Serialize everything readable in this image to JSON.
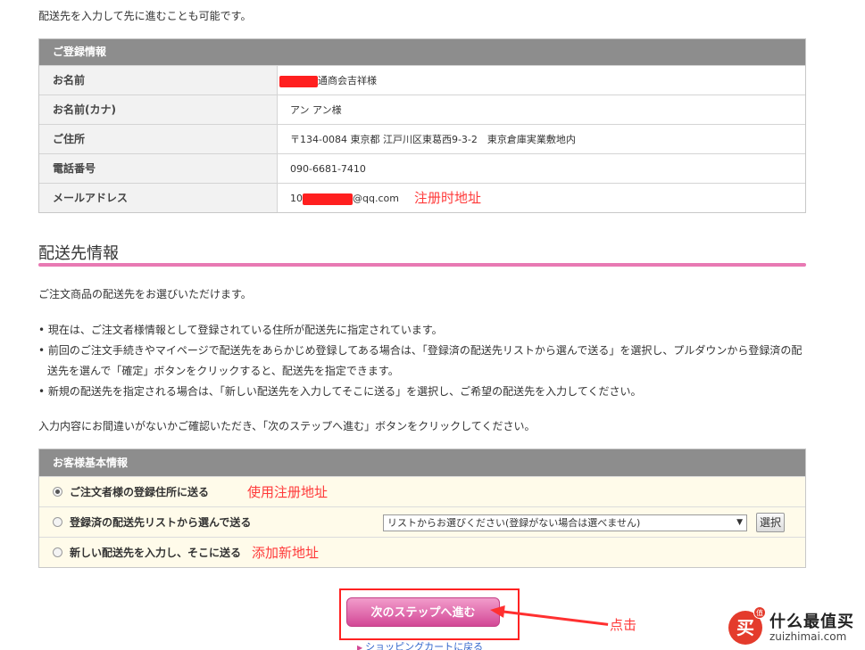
{
  "intro_text": "配送先を入力して先に進むことも可能です。",
  "registration": {
    "header": "ご登録情報",
    "rows": [
      {
        "label": "お名前",
        "value_suffix": "通商会吉祥様"
      },
      {
        "label": "お名前(カナ)",
        "value": "アン アン様"
      },
      {
        "label": "ご住所",
        "value": "〒134-0084 東京都 江戸川区東葛西9-3-2　東京倉庫実業敷地内"
      },
      {
        "label": "電話番号",
        "value": "090-6681-7410"
      },
      {
        "label": "メールアドレス",
        "value_prefix": "10",
        "value_suffix": "@qq.com",
        "annotation": "注册时地址"
      }
    ]
  },
  "delivery": {
    "title": "配送先情報",
    "lead": "ご注文商品の配送先をお選びいただけます。",
    "bullets": [
      "• 現在は、ご注文者様情報として登録されている住所が配送先に指定されています。",
      "• 前回のご注文手続きやマイページで配送先をあらかじめ登録してある場合は、「登録済の配送先リストから選んで送る」を選択し、プルダウンから登録済の配送先を選んで「確定」ボタンをクリックすると、配送先を指定できます。",
      "• 新規の配送先を指定される場合は、「新しい配送先を入力してそこに送る」を選択し、ご希望の配送先を入力してください。"
    ],
    "confirm_text": "入力内容にお間違いがないかご確認いただき、「次のステップへ進む」ボタンをクリックしてください。"
  },
  "customer": {
    "header": "お客様基本情報",
    "options": [
      {
        "label": "ご注文者様の登録住所に送る",
        "selected": true,
        "annotation": "使用注册地址"
      },
      {
        "label": "登録済の配送先リストから選んで送る",
        "selected": false
      },
      {
        "label": "新しい配送先を入力し、そこに送る",
        "selected": false,
        "annotation": "添加新地址"
      }
    ],
    "select_value": "リストからお選びください(登録がない場合は選べません)",
    "select_button": "選択"
  },
  "next_button": "次のステップへ進む",
  "click_annotation": "点击",
  "back_link": "ショッピングカートに戻る",
  "watermark": {
    "logo_char": "买",
    "badge": "值",
    "name": "什么最值买",
    "url": "zuizhimai.com"
  },
  "colors": {
    "header_gray": "#8d8d8d",
    "pink_rule": "#e879b3",
    "button_pink": "#d34896",
    "annotation_red": "#ff3a3a",
    "option_bg": "#fffbea"
  }
}
